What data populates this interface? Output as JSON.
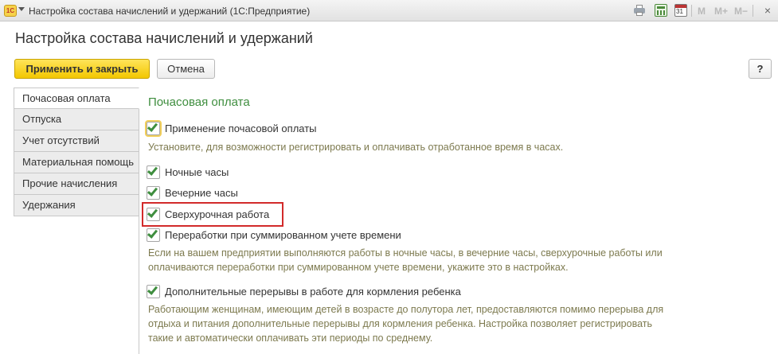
{
  "window": {
    "logo_text": "1С",
    "title": "Настройка состава начислений и удержаний  (1С:Предприятие)",
    "memory_buttons": [
      "M",
      "M+",
      "M−"
    ],
    "close_symbol": "×",
    "calendar_day": "31"
  },
  "page_title": "Настройка состава начислений и удержаний",
  "toolbar": {
    "apply_close_label": "Применить и закрыть",
    "cancel_label": "Отмена",
    "help_label": "?"
  },
  "tabs": [
    {
      "label": "Почасовая оплата",
      "active": true
    },
    {
      "label": "Отпуска",
      "active": false
    },
    {
      "label": "Учет отсутствий",
      "active": false
    },
    {
      "label": "Материальная помощь",
      "active": false
    },
    {
      "label": "Прочие начисления",
      "active": false
    },
    {
      "label": "Удержания",
      "active": false
    }
  ],
  "content": {
    "section_title": "Почасовая оплата",
    "hourly": {
      "label": "Применение почасовой оплаты",
      "checked": true,
      "hint": "Установите, для возможности регистрировать и оплачивать отработанное время в часах."
    },
    "night_hours": {
      "label": "Ночные часы",
      "checked": true
    },
    "evening_hours": {
      "label": "Вечерние часы",
      "checked": true
    },
    "overtime": {
      "label": "Сверхурочная работа",
      "checked": true
    },
    "summarized": {
      "label": "Переработки при суммированном учете времени",
      "checked": true,
      "hint_line1": "Если на вашем предприятии выполняются работы в ночные часы, в вечерние часы, сверхурочные работы или",
      "hint_line2": "оплачиваются переработки при суммированном учете времени, укажите это в настройках."
    },
    "feeding_breaks": {
      "label": "Дополнительные перерывы в работе для кормления ребенка",
      "checked": true,
      "hint_line1": "Работающим женщинам, имеющим детей в возрасте до полутора лет, предоставляются помимо перерыва для",
      "hint_line2": "отдыха и питания дополнительные перерывы для кормления ребенка. Настройка позволяет регистрировать",
      "hint_line3": "такие и автоматически оплачивать эти периоды по среднему."
    }
  },
  "colors": {
    "accent_green": "#3f8e3f",
    "primary_button": "#f3c700",
    "highlight_red": "#d22a2a",
    "hint_text": "#7d7a4f"
  }
}
